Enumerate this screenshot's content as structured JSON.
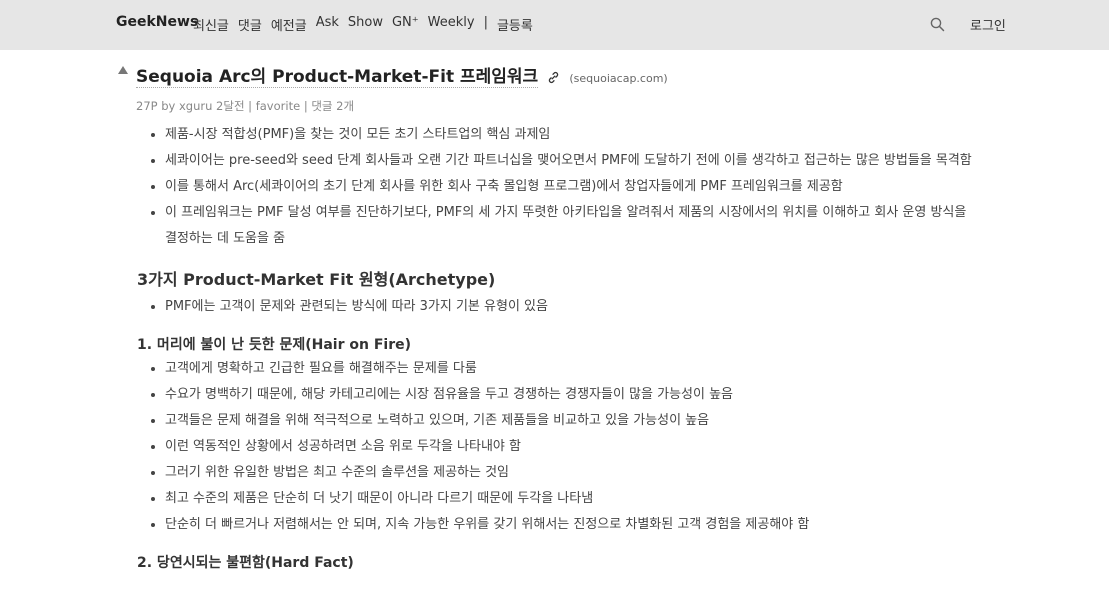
{
  "header": {
    "brand": "GeekNews",
    "nav": [
      "최신글",
      "댓글",
      "예전글",
      "Ask",
      "Show",
      "GN⁺",
      "Weekly",
      "|",
      "글등록"
    ],
    "login": "로그인",
    "search_icon": "search-icon"
  },
  "post": {
    "title": "Sequoia Arc의 Product-Market-Fit 프레임워크",
    "domain": "(sequoiacap.com)",
    "meta": "27P by xguru 2달전 | favorite | 댓글 2개"
  },
  "intro": [
    "제품-시장 적합성(PMF)을 찾는 것이 모든 초기 스타트업의 핵심 과제임",
    "세콰이어는 pre-seed와 seed 단계 회사들과 오랜 기간 파트너십을 맺어오면서 PMF에 도달하기 전에 이를 생각하고 접근하는 많은 방법들을 목격함",
    "이를 통해서 Arc(세콰이어의 초기 단계 회사를 위한 회사 구축 몰입형 프로그램)에서 창업자들에게 PMF 프레임워크를 제공함",
    "이 프레임워크는 PMF 달성 여부를 진단하기보다, PMF의 세 가지 뚜렷한 아키타입을 알려줘서 제품의 시장에서의 위치를 이해하고 회사 운영 방식을 결정하는 데 도움을 줌"
  ],
  "section_archetype": {
    "heading": "3가지 Product-Market Fit 원형(Archetype)",
    "items": [
      "PMF에는 고객이 문제와 관련되는 방식에 따라 3가지 기본 유형이 있음"
    ]
  },
  "section_1": {
    "heading": "1. 머리에 불이 난 듯한 문제(Hair on Fire)",
    "items": [
      "고객에게 명확하고 긴급한 필요를 해결해주는 문제를 다룸",
      "수요가 명백하기 때문에, 해당 카테고리에는 시장 점유율을 두고 경쟁하는 경쟁자들이 많을 가능성이 높음",
      "고객들은 문제 해결을 위해 적극적으로 노력하고 있으며, 기존 제품들을 비교하고 있을 가능성이 높음",
      "이런 역동적인 상황에서 성공하려면 소음 위로 두각을 나타내야 함",
      "그러기 위한 유일한 방법은 최고 수준의 솔루션을 제공하는 것임",
      "최고 수준의 제품은 단순히 더 낫기 때문이 아니라 다르기 때문에 두각을 나타냄",
      "단순히 더 빠르거나 저렴해서는 안 되며, 지속 가능한 우위를 갖기 위해서는 진정으로 차별화된 고객 경험을 제공해야 함"
    ]
  },
  "section_2": {
    "heading": "2. 당연시되는 불편함(Hard Fact)"
  }
}
